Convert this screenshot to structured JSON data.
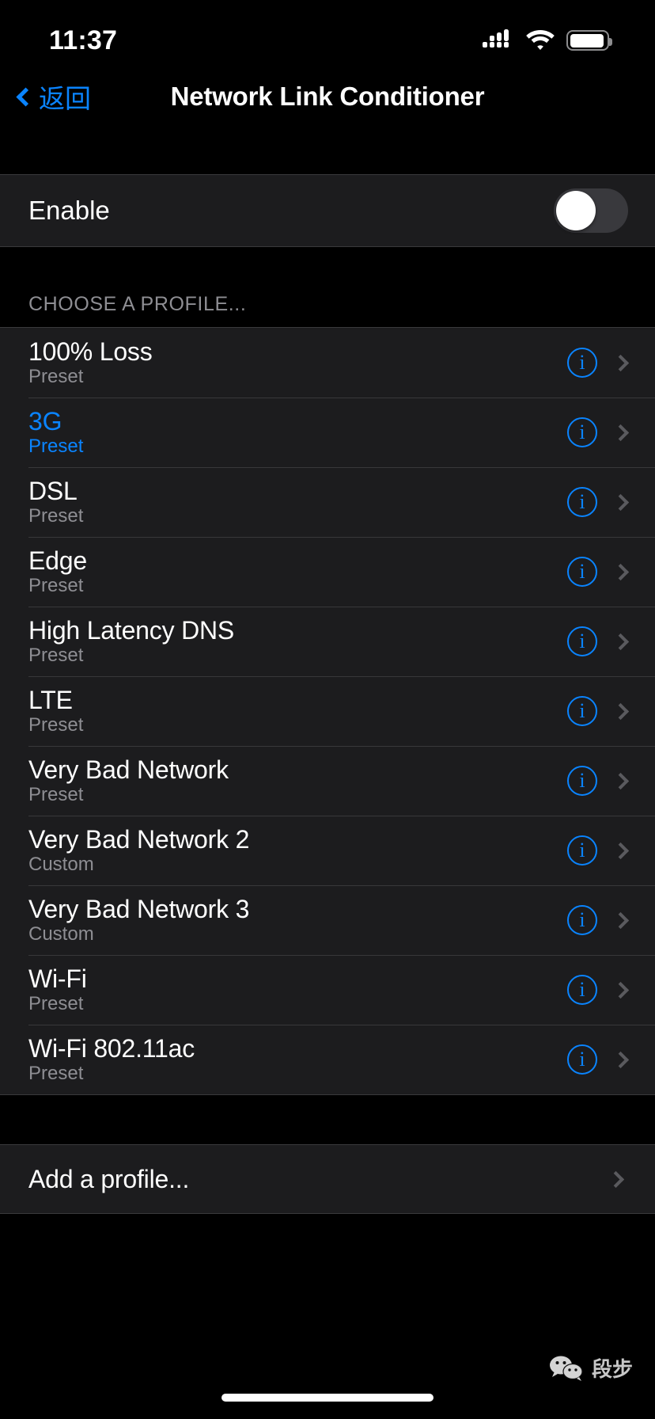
{
  "status_bar": {
    "time": "11:37",
    "icons": [
      "cellular-signal-icon",
      "wifi-icon",
      "battery-icon"
    ],
    "battery_level_pct": 95
  },
  "nav_bar": {
    "back_label": "返回",
    "back_icon": "chevron-left-icon",
    "title": "Network Link Conditioner"
  },
  "enable_section": {
    "label": "Enable",
    "toggle_state": "off"
  },
  "profiles_section": {
    "header": "CHOOSE A PROFILE...",
    "info_icon": "info-circle-icon",
    "disclosure_icon": "chevron-right-icon",
    "rows": [
      {
        "title": "100% Loss",
        "subtitle": "Preset",
        "selected": false
      },
      {
        "title": "3G",
        "subtitle": "Preset",
        "selected": true
      },
      {
        "title": "DSL",
        "subtitle": "Preset",
        "selected": false
      },
      {
        "title": "Edge",
        "subtitle": "Preset",
        "selected": false
      },
      {
        "title": "High Latency DNS",
        "subtitle": "Preset",
        "selected": false
      },
      {
        "title": "LTE",
        "subtitle": "Preset",
        "selected": false
      },
      {
        "title": "Very Bad Network",
        "subtitle": "Preset",
        "selected": false
      },
      {
        "title": "Very Bad Network 2",
        "subtitle": "Custom",
        "selected": false
      },
      {
        "title": "Very Bad Network 3",
        "subtitle": "Custom",
        "selected": false
      },
      {
        "title": "Wi-Fi",
        "subtitle": "Preset",
        "selected": false
      },
      {
        "title": "Wi-Fi 802.11ac",
        "subtitle": "Preset",
        "selected": false
      }
    ]
  },
  "add_section": {
    "label": "Add a profile...",
    "disclosure_icon": "chevron-right-icon"
  },
  "watermark": {
    "icon": "wechat-icon",
    "text": "段步"
  },
  "colors": {
    "accent_blue": "#0a84ff",
    "page_background": "#000000",
    "cell_background": "#1c1c1e",
    "separator": "#38383a",
    "secondary_text": "#8e8e93",
    "toggle_track_off": "#39393d"
  }
}
